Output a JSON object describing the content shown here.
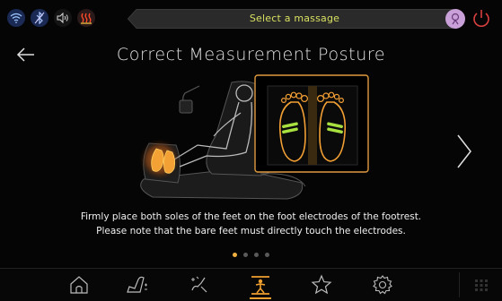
{
  "header": {
    "select_label": "Select a massage",
    "status_icons": [
      "wifi-icon",
      "bluetooth-icon",
      "speaker-icon",
      "heat-icon"
    ],
    "user_icon": "user-icon",
    "power_icon": "power-icon"
  },
  "page": {
    "title": "Correct Measurement Posture",
    "back_icon": "arrow-left-icon",
    "next_icon": "chevron-right-icon"
  },
  "instructions": {
    "line1": "Firmly place both soles of the feet on the foot electrodes of the footrest.",
    "line2": "Please note that the bare feet must directly touch the electrodes."
  },
  "pagination": {
    "total": 4,
    "current": 1
  },
  "bottom_nav": {
    "items": [
      "home-icon",
      "recline-icon",
      "massage-icon",
      "posture-icon",
      "favorite-icon",
      "settings-icon"
    ],
    "active": "posture-icon",
    "grid_icon": "grid-menu-icon"
  },
  "colors": {
    "accent": "#f0a030",
    "select_text": "#d8e060",
    "power": "#d84040",
    "electrode": "#a8e040"
  }
}
